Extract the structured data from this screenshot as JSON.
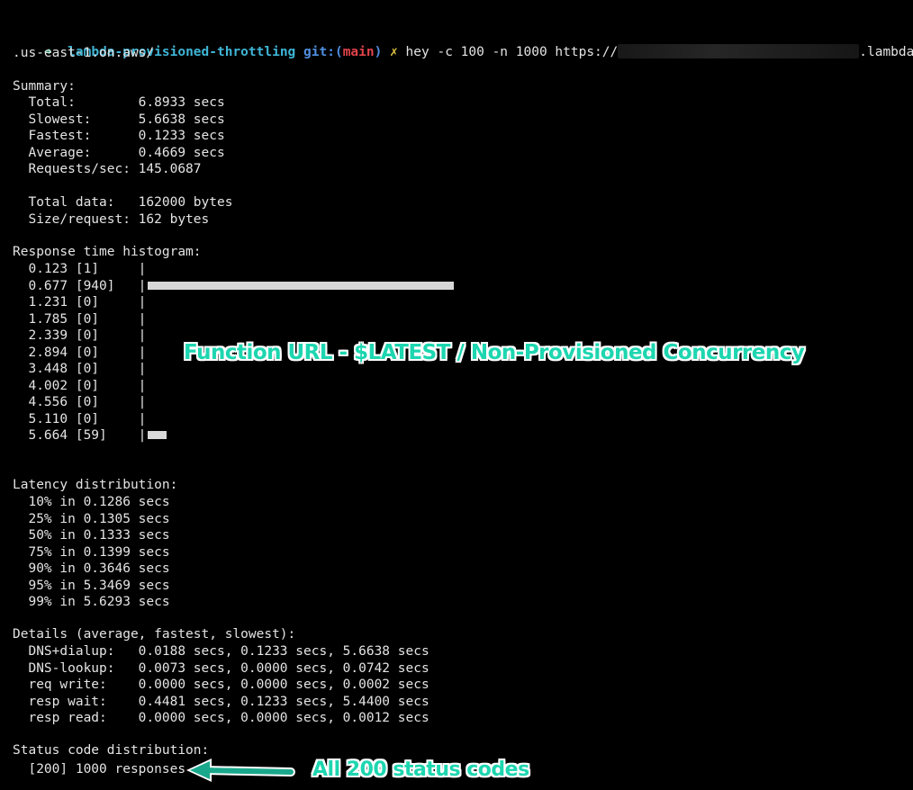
{
  "prompt": {
    "arrow": "➜",
    "directory": "lambda-provisioned-throttling",
    "git_prefix": "git:(",
    "branch": "main",
    "git_suffix": ")",
    "dirty_mark": "✗",
    "command": "hey -c 100 -n 1000 https://",
    "url_suffix": ".lambda-url",
    "url_cont": ".us-east-1.on.aws/"
  },
  "summary": {
    "heading": "Summary:",
    "rows": [
      "  Total:        6.8933 secs",
      "  Slowest:      5.6638 secs",
      "  Fastest:      0.1233 secs",
      "  Average:      0.4669 secs",
      "  Requests/sec: 145.0687"
    ],
    "data_rows": [
      "  Total data:   162000 bytes",
      "  Size/request: 162 bytes"
    ]
  },
  "histogram": {
    "heading": "Response time histogram:",
    "max_count": 940,
    "rows": [
      {
        "label": "  0.123 [1]     |",
        "count": 1
      },
      {
        "label": "  0.677 [940]   |",
        "count": 940
      },
      {
        "label": "  1.231 [0]     |",
        "count": 0
      },
      {
        "label": "  1.785 [0]     |",
        "count": 0
      },
      {
        "label": "  2.339 [0]     |",
        "count": 0
      },
      {
        "label": "  2.894 [0]     |",
        "count": 0
      },
      {
        "label": "  3.448 [0]     |",
        "count": 0
      },
      {
        "label": "  4.002 [0]     |",
        "count": 0
      },
      {
        "label": "  4.556 [0]     |",
        "count": 0
      },
      {
        "label": "  5.110 [0]     |",
        "count": 0
      },
      {
        "label": "  5.664 [59]    |",
        "count": 59
      }
    ]
  },
  "latency": {
    "heading": "Latency distribution:",
    "rows": [
      "  10% in 0.1286 secs",
      "  25% in 0.1305 secs",
      "  50% in 0.1333 secs",
      "  75% in 0.1399 secs",
      "  90% in 0.3646 secs",
      "  95% in 5.3469 secs",
      "  99% in 5.6293 secs"
    ]
  },
  "details": {
    "heading": "Details (average, fastest, slowest):",
    "rows": [
      "  DNS+dialup:   0.0188 secs, 0.1233 secs, 5.6638 secs",
      "  DNS-lookup:   0.0073 secs, 0.0000 secs, 0.0742 secs",
      "  req write:    0.0000 secs, 0.0000 secs, 0.0002 secs",
      "  resp wait:    0.4481 secs, 0.1233 secs, 5.4400 secs",
      "  resp read:    0.0000 secs, 0.0000 secs, 0.0012 secs"
    ]
  },
  "status": {
    "heading": "Status code distribution:",
    "rows": [
      "  [200] 1000 responses"
    ]
  },
  "annotations": {
    "function_url": "Function URL - $LATEST / Non-Provisioned Concurrency",
    "all_200": "All 200 status codes",
    "color": "#1dd6b0"
  }
}
